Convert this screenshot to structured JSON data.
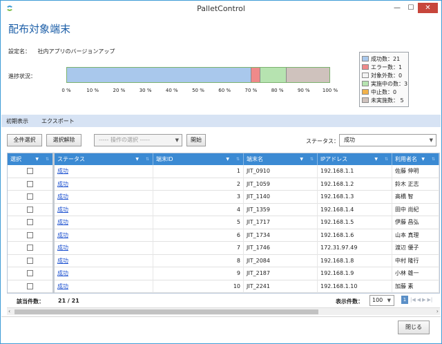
{
  "window": {
    "title": "PalletControl",
    "min_glyph": "—",
    "max_glyph": "☐",
    "close_glyph": "✕"
  },
  "page_title": "配布対象端末",
  "setting": {
    "label": "設定名：",
    "value": "社内アプリのバージョンアップ"
  },
  "progress": {
    "label": "進捗状況：",
    "segments": [
      {
        "name": "成功数",
        "value": 21,
        "color": "#a9c8ec"
      },
      {
        "name": "エラー数",
        "value": 1,
        "color": "#ef8a8a"
      },
      {
        "name": "実施中の数",
        "value": 3,
        "color": "#b6e3b0"
      },
      {
        "name": "未実施数",
        "value": 5,
        "color": "#cfc2bd"
      }
    ],
    "total": 30,
    "ticks": [
      "0 %",
      "10 %",
      "20 %",
      "30 %",
      "40 %",
      "50 %",
      "60 %",
      "70 %",
      "80 %",
      "90 %",
      "100 %"
    ]
  },
  "legend": [
    {
      "label": "成功数：21",
      "color": "#a9c8ec"
    },
    {
      "label": "エラー数：1",
      "color": "#ef8a8a"
    },
    {
      "label": "対象外数：0",
      "color": "#f4f4f4"
    },
    {
      "label": "実施中の数：3",
      "color": "#b6e3b0"
    },
    {
      "label": "中止数：0",
      "color": "#f2b24a"
    },
    {
      "label": "未実施数： 5",
      "color": "#cfc2bd"
    }
  ],
  "tabs": [
    "初期表示",
    "エクスポート"
  ],
  "toolbar": {
    "select_all": "全件選択",
    "deselect": "選択解除",
    "operation_placeholder": "----- 操作の選択 -----",
    "start": "開始",
    "status_label": "ステータス：",
    "status_value": "成功"
  },
  "grid": {
    "columns": [
      "選択",
      "ステータス",
      "端末ID",
      "端末名",
      "IPアドレス",
      "利用者名"
    ],
    "rows": [
      {
        "status": "成功",
        "id": "1",
        "name": "JIT_0910",
        "ip": "192.168.1.1",
        "user": "佐藤 伸明"
      },
      {
        "status": "成功",
        "id": "2",
        "name": "JIT_1059",
        "ip": "192.168.1.2",
        "user": "鈴木 正志"
      },
      {
        "status": "成功",
        "id": "3",
        "name": "JIT_1140",
        "ip": "192.168.1.3",
        "user": "高橋 智"
      },
      {
        "status": "成功",
        "id": "4",
        "name": "JIT_1359",
        "ip": "192.168.1.4",
        "user": "田中 尚紀"
      },
      {
        "status": "成功",
        "id": "5",
        "name": "JIT_1717",
        "ip": "192.168.1.5",
        "user": "伊藤 昌弘"
      },
      {
        "status": "成功",
        "id": "6",
        "name": "JIT_1734",
        "ip": "192.168.1.6",
        "user": "山本 真理"
      },
      {
        "status": "成功",
        "id": "7",
        "name": "JIT_1746",
        "ip": "172.31.97.49",
        "user": "渡辺 優子"
      },
      {
        "status": "成功",
        "id": "8",
        "name": "JIT_2084",
        "ip": "192.168.1.8",
        "user": "中村 隆行"
      },
      {
        "status": "成功",
        "id": "9",
        "name": "JIT_2187",
        "ip": "192.168.1.9",
        "user": "小林 雄一"
      },
      {
        "status": "成功",
        "id": "10",
        "name": "JIT_2241",
        "ip": "192.168.1.10",
        "user": "加藤 素"
      }
    ]
  },
  "footer": {
    "count_label": "該当件数：",
    "count_value": "21 / 21",
    "perpage_label": "表示件数：",
    "perpage_value": "100",
    "page": "1",
    "close_button": "閉じる"
  }
}
